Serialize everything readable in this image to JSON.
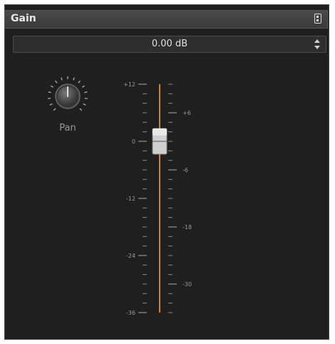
{
  "header": {
    "title": "Gain"
  },
  "value_field": {
    "value": "0.00 dB"
  },
  "knob": {
    "label": "Pan",
    "value": 0
  },
  "fader": {
    "value_db": 0,
    "left_scale": [
      "+12",
      "0",
      "-12",
      "-24",
      "-36"
    ],
    "right_scale": [
      "+6",
      "-6",
      "-18",
      "-30"
    ],
    "track_color": "#c8883a"
  },
  "colors": {
    "panel_bg": "#1f1f1f",
    "header_bg": "#424242",
    "text": "#e0e0e0",
    "dim_text": "#9a9a9a"
  }
}
